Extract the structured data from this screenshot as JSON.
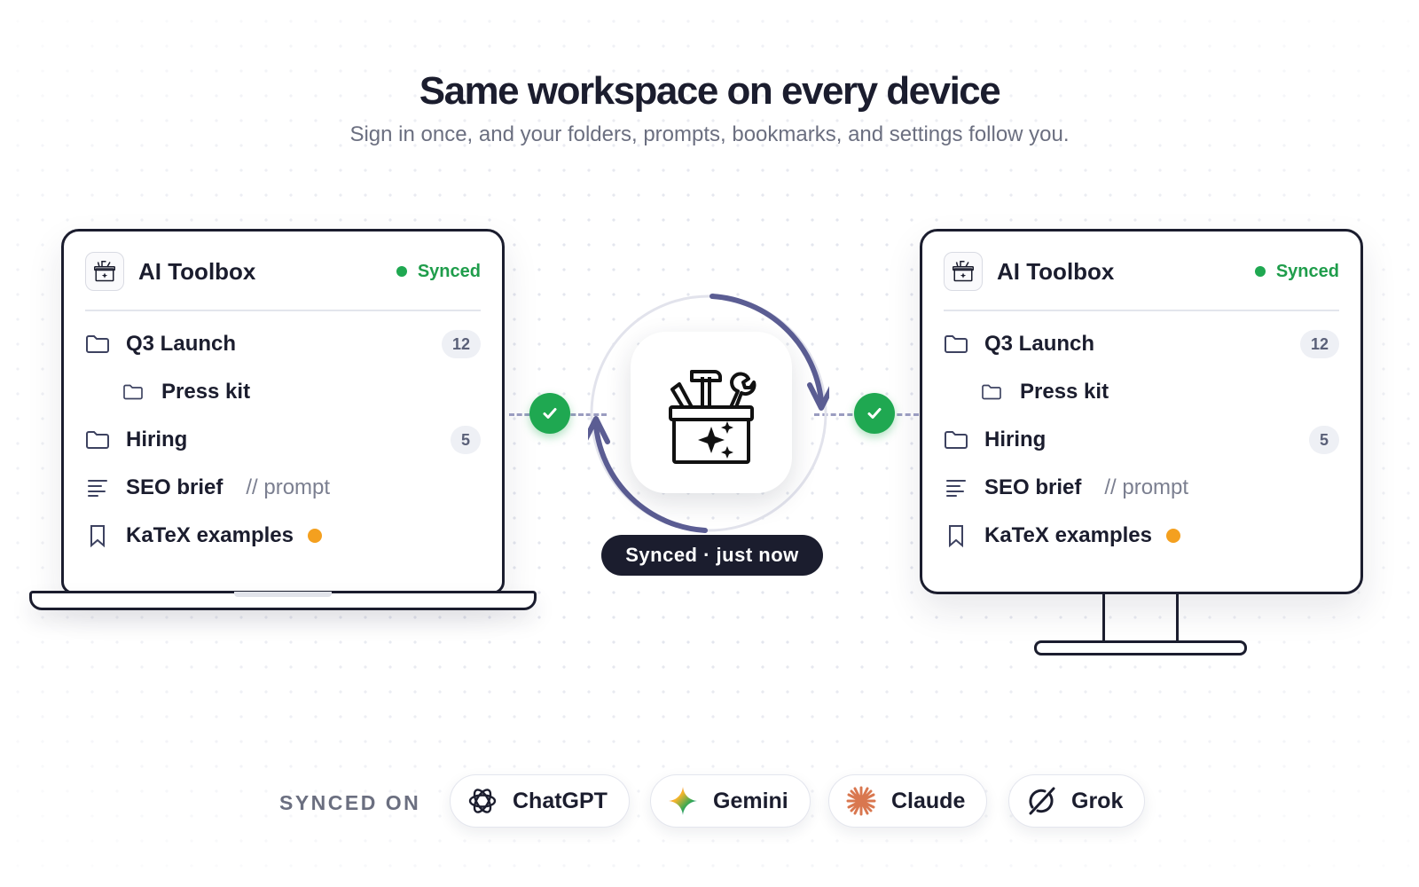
{
  "hero": {
    "title": "Same workspace on every device",
    "subtitle": "Sign in once, and your folders, prompts, bookmarks, and settings follow you."
  },
  "devices": [
    {
      "kind": "laptop",
      "app_title": "AI Toolbox",
      "status": "Synced",
      "items": [
        {
          "type": "folder",
          "label": "Q3 Launch",
          "count": "12"
        },
        {
          "type": "subfolder",
          "label": "Press kit"
        },
        {
          "type": "folder",
          "label": "Hiring",
          "count": "5"
        },
        {
          "type": "prompt",
          "label": "SEO brief",
          "tag": "// prompt"
        },
        {
          "type": "bookmark",
          "label": "KaTeX examples"
        }
      ]
    },
    {
      "kind": "monitor",
      "app_title": "AI Toolbox",
      "status": "Synced",
      "items": [
        {
          "type": "folder",
          "label": "Q3 Launch",
          "count": "12"
        },
        {
          "type": "subfolder",
          "label": "Press kit"
        },
        {
          "type": "folder",
          "label": "Hiring",
          "count": "5"
        },
        {
          "type": "prompt",
          "label": "SEO brief",
          "tag": "// prompt"
        },
        {
          "type": "bookmark",
          "label": "KaTeX examples"
        }
      ]
    }
  ],
  "hub": {
    "status_pill": "Synced · just now",
    "icon": "toolbox-sparkle-icon"
  },
  "footer": {
    "label": "SYNCED ON",
    "platforms": [
      {
        "name": "ChatGPT",
        "icon": "chatgpt-icon"
      },
      {
        "name": "Gemini",
        "icon": "gemini-icon"
      },
      {
        "name": "Claude",
        "icon": "claude-icon"
      },
      {
        "name": "Grok",
        "icon": "grok-icon"
      }
    ]
  },
  "colors": {
    "ink": "#1b1d2e",
    "synced_green": "#1fa851",
    "accent_arrows": "#5b5d93",
    "dot_orange": "#f4a01f"
  }
}
